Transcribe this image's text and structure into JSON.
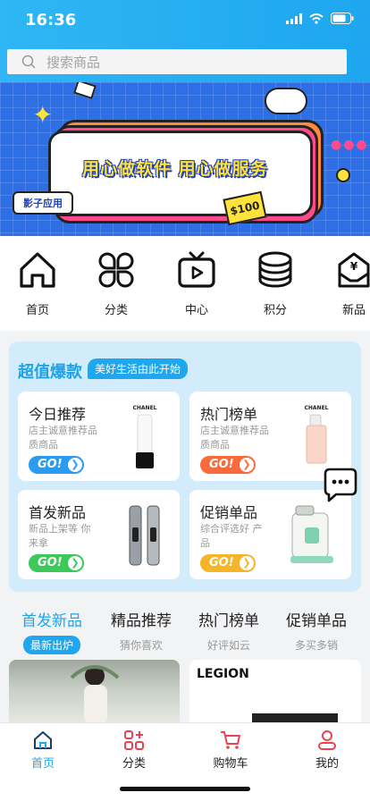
{
  "status": {
    "time": "16:36"
  },
  "search": {
    "placeholder": "搜索商品"
  },
  "banner": {
    "slogan": "用心做软件 用心做服务",
    "tag": "影子应用",
    "money": "$100"
  },
  "nav": [
    {
      "label": "首页",
      "icon": "home-icon"
    },
    {
      "label": "分类",
      "icon": "category-icon"
    },
    {
      "label": "中心",
      "icon": "tv-icon"
    },
    {
      "label": "积分",
      "icon": "coins-icon"
    },
    {
      "label": "新品",
      "icon": "new-product-icon"
    }
  ],
  "deal": {
    "title": "超值爆款",
    "subtitle": "美好生活由此开始",
    "go_label": "GO!",
    "cards": [
      {
        "title": "今日推荐",
        "desc": "店主诚意推荐品质商品",
        "go_color": "#2a9bf0",
        "product": "CHANEL"
      },
      {
        "title": "热门榜单",
        "desc": "店主诚意推荐品质商品",
        "go_color": "#fb6a3b",
        "product": "CHANEL"
      },
      {
        "title": "首发新品",
        "desc": "新品上架等 你来拿",
        "go_color": "#3cc95a",
        "product": ""
      },
      {
        "title": "促销单品",
        "desc": "综合评选好 产品",
        "go_color": "#f6b528",
        "product": ""
      }
    ]
  },
  "tabs": [
    {
      "label": "首发新品",
      "sub": "最新出炉"
    },
    {
      "label": "精品推荐",
      "sub": "猜你喜欢"
    },
    {
      "label": "热门榜单",
      "sub": "好评如云"
    },
    {
      "label": "促销单品",
      "sub": "多买多销"
    }
  ],
  "feed": {
    "right_brand": "LEGION"
  },
  "tabbar": [
    {
      "label": "首页",
      "icon": "home-icon"
    },
    {
      "label": "分类",
      "icon": "category-icon"
    },
    {
      "label": "购物车",
      "icon": "cart-icon"
    },
    {
      "label": "我的",
      "icon": "user-icon"
    }
  ],
  "colors": {
    "accent": "#1ea6ef",
    "tab_red": "#e8434f"
  }
}
